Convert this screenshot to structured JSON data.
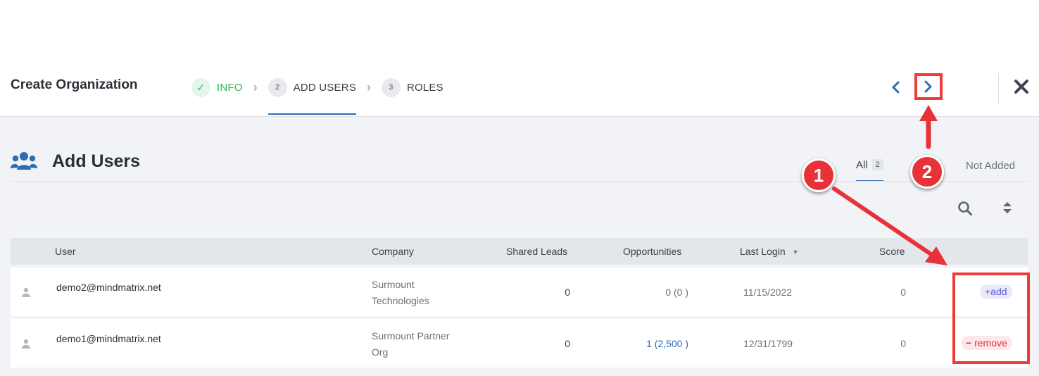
{
  "header": {
    "title": "Create Organization",
    "steps": [
      {
        "num": "✓",
        "label": "INFO"
      },
      {
        "num": "2",
        "label": "ADD USERS"
      },
      {
        "num": "3",
        "label": "ROLES"
      }
    ],
    "prev_glyph": "‹",
    "next_glyph": "›",
    "close_glyph": "✕"
  },
  "section": {
    "title": "Add Users",
    "filters": {
      "all_label": "All",
      "all_count": "2",
      "not_added_label": "Not Added"
    }
  },
  "table": {
    "columns": [
      "User",
      "Company",
      "Shared Leads",
      "Opportunities",
      "Last Login",
      "Score"
    ],
    "sort_glyph": "▼",
    "rows": [
      {
        "email": "demo2@mindmatrix.net",
        "company_line1": "Surmount",
        "company_line2": "Technologies",
        "shared_leads": "0",
        "opportunities": "0 (0 )",
        "last_login": "11/15/2022",
        "score": "0",
        "action": "+add"
      },
      {
        "email": "demo1@mindmatrix.net",
        "company_line1": "Surmount Partner",
        "company_line2": "Org",
        "shared_leads": "0",
        "opportunities": "1 (2,500 )",
        "last_login": "12/31/1799",
        "score": "0",
        "action": "remove"
      }
    ]
  },
  "annotations": {
    "badge_1": "1",
    "badge_2": "2",
    "color": "#e8323a"
  },
  "colors": {
    "accent": "#2d6cb4",
    "success": "#2fb65a",
    "add": "#5b5bd6",
    "remove": "#e0303f"
  }
}
